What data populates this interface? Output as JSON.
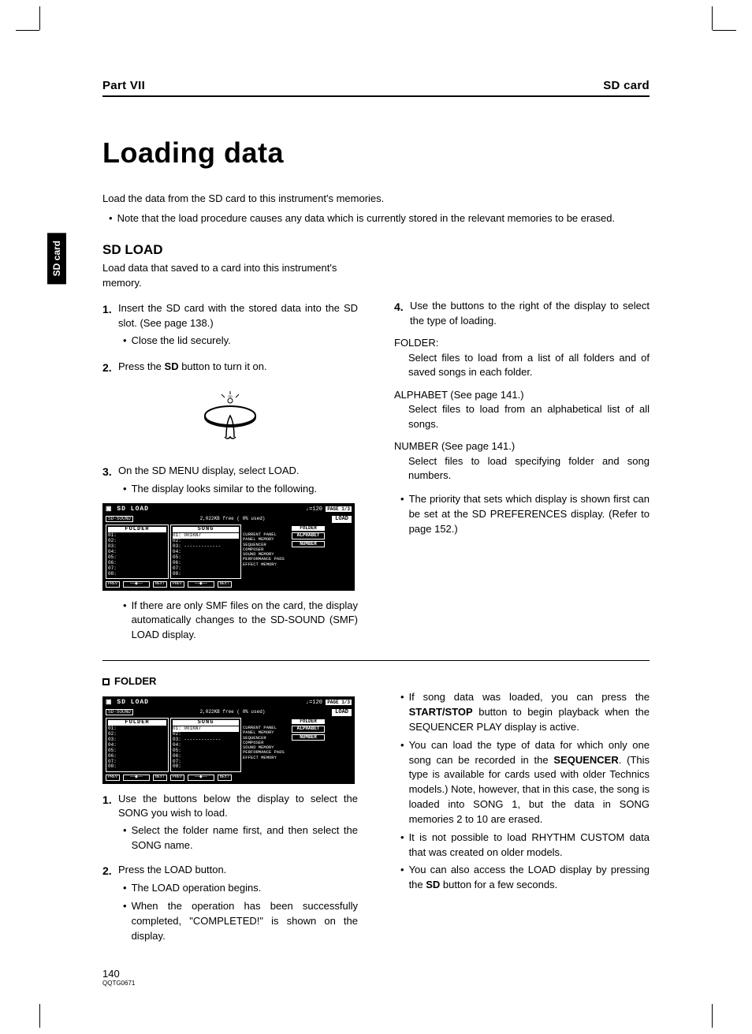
{
  "header": {
    "part": "Part VII",
    "section": "SD card"
  },
  "side_tab": "SD card",
  "title": "Loading data",
  "intro": "Load the data from the SD card to this instrument's memories.",
  "intro_bullet": "Note that the load procedure causes any data which is currently stored in the relevant memories to be erased.",
  "sd_load": {
    "heading": "SD LOAD",
    "desc": "Load data that saved to a card into this instrument's memory.",
    "step1": "Insert the SD card with the stored data into the SD slot. (See page 138.)",
    "step1_b": "Close the lid securely.",
    "step2_pre": "Press the ",
    "step2_bold": "SD",
    "step2_post": " button to turn it on.",
    "step3": "On the SD MENU display, select LOAD.",
    "step3_b": "The display looks similar to the following.",
    "smf_note": "If there are only SMF files on the card, the display automatically changes to the SD-SOUND (SMF) LOAD display.",
    "step4": "Use the buttons to the right of the display to select the type of loading.",
    "folder_term": "FOLDER:",
    "folder_def": "Select files to load from a list of all folders and of saved songs in each folder.",
    "alpha_term": "ALPHABET (See page 141.)",
    "alpha_def": "Select files to load from an alphabetical list of all songs.",
    "number_term": "NUMBER (See page 141.)",
    "number_def": "Select files to load specifying folder and song numbers.",
    "priority_note": "The priority that sets which display is shown first can be set at the SD PREFERENCES display. (Refer to page 152.)"
  },
  "lcd": {
    "title": "SD LOAD",
    "tempo": "♩=120",
    "page": "PAGE 1/3",
    "sd_sound": "SD-SOUND",
    "free": "2,022KB free ( 0% used)",
    "load_btn": "LOAD",
    "folder_h": "FOLDER",
    "song_h": "SONG",
    "folders": [
      "01:",
      "02:",
      "03:",
      "04:",
      "05:",
      "06:",
      "07:",
      "08:"
    ],
    "songs": [
      "01: 001KN7",
      "02:",
      "03: -------------",
      "04:",
      "05:",
      "06:",
      "07:",
      "08:"
    ],
    "side_labels": [
      "CURRENT PANEL",
      "PANEL MEMORY",
      "SEQUENCER",
      "COMPOSER",
      "SOUND MEMORY",
      "PERFORMANCE PADS",
      "EFFECT MEMORY"
    ],
    "rbtn_folder": "FOLDER",
    "rbtn_alpha": "ALPHABET",
    "rbtn_num": "NUMBER",
    "prev": "PREV",
    "next": "NEXT"
  },
  "folder_section": {
    "heading": "FOLDER",
    "step1": "Use the buttons below the display to select the SONG you wish to load.",
    "step1_b": "Select the folder name first, and then select the SONG name.",
    "step2": "Press the LOAD button.",
    "step2_b1": "The LOAD operation begins.",
    "step2_b2": "When the operation has been successfully completed, \"COMPLETED!\" is shown on the display.",
    "r1_pre": "If song data was loaded, you can press the ",
    "r1_bold": "START/STOP",
    "r1_post": " button to begin playback when the SEQUENCER PLAY display is active.",
    "r2_pre": "You can load the type of data for which only one song can be recorded in the ",
    "r2_bold": "SEQUENCER",
    "r2_post": ". (This type is available for cards used with older Technics models.) Note, however, that in this case, the song is loaded into SONG 1, but the data in SONG memories 2 to 10 are erased.",
    "r3": "It is not possible to load RHYTHM CUSTOM data that was created on older models.",
    "r4_pre": "You can also access the LOAD display by pressing the ",
    "r4_bold": "SD",
    "r4_post": " button for a few seconds."
  },
  "footer": {
    "page_number": "140",
    "doc_code": "QQTG0671"
  }
}
